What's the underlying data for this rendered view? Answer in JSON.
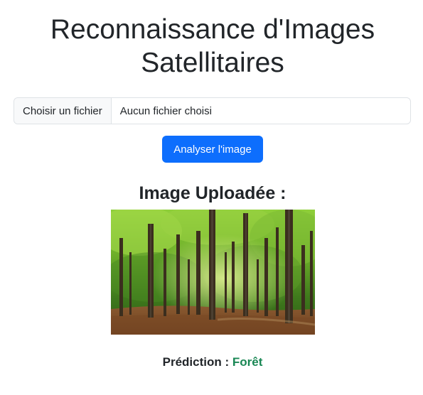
{
  "title_line1": "Reconnaissance d'Images",
  "title_line2": "Satellitaires",
  "file_input": {
    "button_label": "Choisir un fichier",
    "status": "Aucun fichier choisi"
  },
  "submit_label": "Analyser l'image",
  "uploaded_heading": "Image Uploadée :",
  "uploaded_image": {
    "subject": "forest"
  },
  "prediction": {
    "label": "Prédiction :",
    "value": "Forêt"
  },
  "colors": {
    "primary_button": "#0d6efd",
    "prediction_value": "#198754",
    "text": "#212529"
  }
}
